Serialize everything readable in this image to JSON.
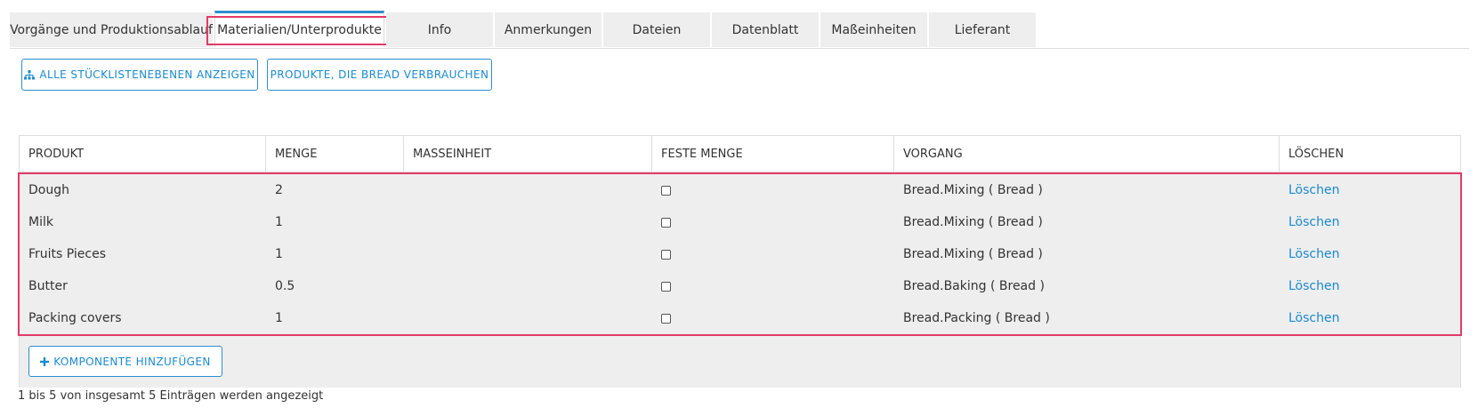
{
  "tabs": [
    {
      "label": "Vorgänge und Produktionsablauf"
    },
    {
      "label": "Materialien/Unterprodukte"
    },
    {
      "label": "Info"
    },
    {
      "label": "Anmerkungen"
    },
    {
      "label": "Dateien"
    },
    {
      "label": "Datenblatt"
    },
    {
      "label": "Maßeinheiten"
    },
    {
      "label": "Lieferant"
    }
  ],
  "active_tab": "Materialien/Unterprodukte",
  "toolbar": {
    "show_levels_label": "ALLE STÜCKLISTENEBENEN ANZEIGEN",
    "products_using_label": "PRODUKTE, DIE BREAD VERBRAUCHEN"
  },
  "table": {
    "headers": [
      "PRODUKT",
      "MENGE",
      "MASSEINHEIT",
      "FESTE MENGE",
      "VORGANG",
      "LÖSCHEN"
    ],
    "rows": [
      {
        "produkt": "Dough",
        "menge": "2",
        "masseinheit": "",
        "feste_menge": false,
        "vorgang": "Bread.Mixing ( Bread )",
        "loeschen": "Löschen"
      },
      {
        "produkt": "Milk",
        "menge": "1",
        "masseinheit": "",
        "feste_menge": false,
        "vorgang": "Bread.Mixing ( Bread )",
        "loeschen": "Löschen"
      },
      {
        "produkt": "Fruits Pieces",
        "menge": "1",
        "masseinheit": "",
        "feste_menge": false,
        "vorgang": "Bread.Mixing ( Bread )",
        "loeschen": "Löschen"
      },
      {
        "produkt": "Butter",
        "menge": "0.5",
        "masseinheit": "",
        "feste_menge": false,
        "vorgang": "Bread.Baking ( Bread )",
        "loeschen": "Löschen"
      },
      {
        "produkt": "Packing covers",
        "menge": "1",
        "masseinheit": "",
        "feste_menge": false,
        "vorgang": "Bread.Packing ( Bread )",
        "loeschen": "Löschen"
      }
    ],
    "add_component_label": "KOMPONENTE HINZUFÜGEN"
  },
  "footer": {
    "info": "1 bis 5 von insgesamt 5 Einträgen werden angezeigt"
  },
  "colors": {
    "accent": "#2e8ecf",
    "link": "#1a8ad0",
    "highlight": "#e23a6a",
    "row_bg": "#eeeeee"
  }
}
